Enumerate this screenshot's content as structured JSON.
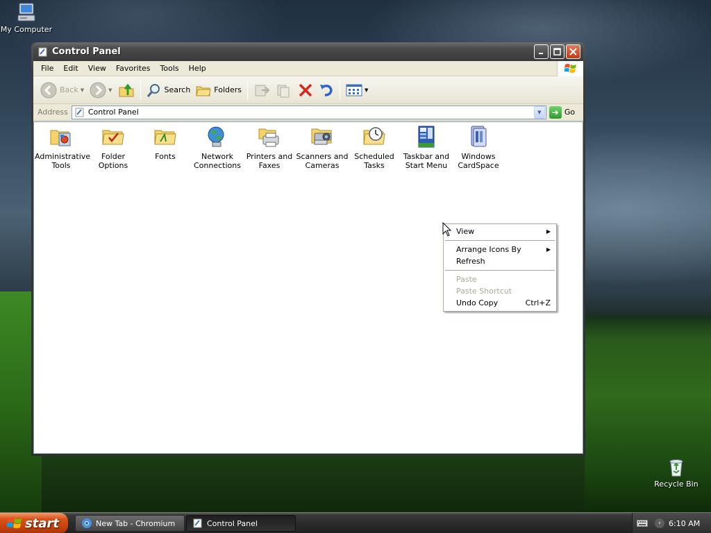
{
  "desktop": {
    "icons": [
      {
        "label": "My Computer",
        "icon": "my-computer-icon"
      },
      {
        "label": "Recycle Bin",
        "icon": "recycle-bin-icon"
      }
    ]
  },
  "window": {
    "title": "Control Panel",
    "menu": [
      "File",
      "Edit",
      "View",
      "Favorites",
      "Tools",
      "Help"
    ],
    "toolbar": {
      "back_label": "Back",
      "search_label": "Search",
      "folders_label": "Folders"
    },
    "address": {
      "label": "Address",
      "value": "Control Panel",
      "go_label": "Go"
    },
    "items": [
      {
        "line1": "Administrative",
        "line2": "Tools",
        "icon": "administrative-tools-icon"
      },
      {
        "line1": "Folder Options",
        "line2": "",
        "icon": "folder-options-icon"
      },
      {
        "line1": "Fonts",
        "line2": "",
        "icon": "fonts-folder-icon"
      },
      {
        "line1": "Network",
        "line2": "Connections",
        "icon": "network-connections-icon"
      },
      {
        "line1": "Printers and",
        "line2": "Faxes",
        "icon": "printers-faxes-icon"
      },
      {
        "line1": "Scanners and",
        "line2": "Cameras",
        "icon": "scanners-cameras-icon"
      },
      {
        "line1": "Scheduled",
        "line2": "Tasks",
        "icon": "scheduled-tasks-icon"
      },
      {
        "line1": "Taskbar and",
        "line2": "Start Menu",
        "icon": "taskbar-start-menu-icon"
      },
      {
        "line1": "Windows",
        "line2": "CardSpace",
        "icon": "windows-cardspace-icon"
      }
    ]
  },
  "context_menu": {
    "view": "View",
    "arrange": "Arrange Icons By",
    "refresh": "Refresh",
    "paste": "Paste",
    "paste_shortcut": "Paste Shortcut",
    "undo_copy": "Undo Copy",
    "undo_shortcut": "Ctrl+Z"
  },
  "taskbar": {
    "start_label": "start",
    "tasks": [
      {
        "label": "New Tab - Chromium",
        "active": false
      },
      {
        "label": "Control Panel",
        "active": true
      }
    ],
    "clock": "6:10 AM"
  }
}
